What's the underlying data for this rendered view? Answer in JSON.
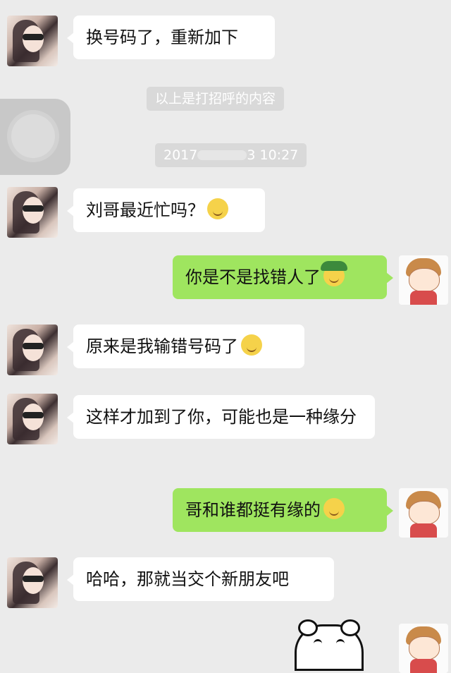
{
  "chat": {
    "messages": [
      {
        "side": "left",
        "text": "换号码了，重新加下"
      },
      {
        "side": "left",
        "text": "刘哥最近忙吗？"
      },
      {
        "side": "right",
        "text": "你是不是找错人了"
      },
      {
        "side": "left",
        "text": "原来是我输错号码了"
      },
      {
        "side": "left",
        "text": "这样才加到了你，可能也是一种缘分"
      },
      {
        "side": "right",
        "text": "哥和谁都挺有缘的"
      },
      {
        "side": "left",
        "text": "哈哈，那就当交个新朋友吧"
      }
    ],
    "system": {
      "greeting_notice": "以上是打招呼的内容",
      "timestamp_start": "2017",
      "timestamp_end": "3 10:27"
    }
  },
  "icons": [
    "contact-avatar",
    "my-avatar",
    "smile-emoji",
    "hat-emoji",
    "dizzy-emoji",
    "bear-sticker",
    "voice-call-avatar"
  ],
  "colors": {
    "background": "#ebebeb",
    "incoming_bubble": "#ffffff",
    "outgoing_bubble": "#9fe55f",
    "system_pill": "#d9d9d9"
  }
}
